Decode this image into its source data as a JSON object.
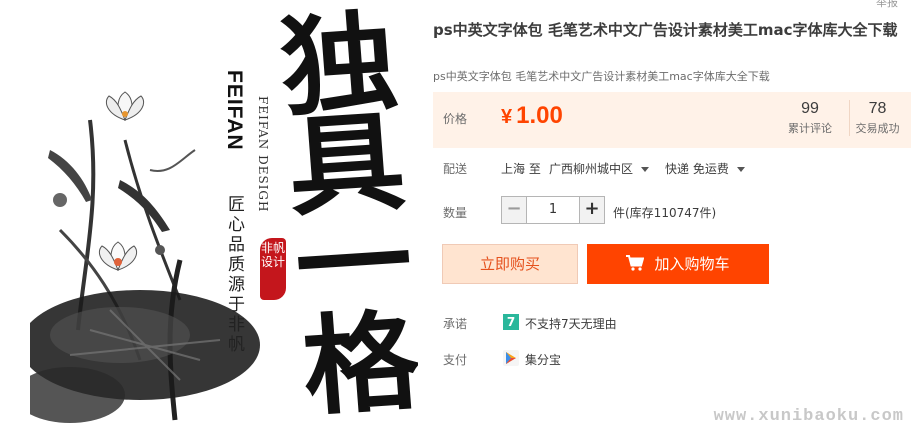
{
  "corner_text": "举报",
  "image": {
    "big_chars": [
      "独",
      "具",
      "一",
      "格"
    ],
    "brand": "FEIFAN",
    "brand_sub": "FEIFAN DESIGH",
    "slogan": "匠心品质源于非帆",
    "seal_text": "非帆设计"
  },
  "product": {
    "title": "ps中英文字体包 毛笔艺术中文广告设计素材美工mac字体库大全下载",
    "subtitle": "ps中英文字体包 毛笔艺术中文广告设计素材美工mac字体库大全下载"
  },
  "price": {
    "label": "价格",
    "currency": "¥",
    "value": "1.00",
    "reviews_count": "99",
    "reviews_label": "累计评论",
    "deals_count": "78",
    "deals_label": "交易成功"
  },
  "shipping": {
    "label": "配送",
    "from": "上海 至",
    "destination": "广西柳州城中区",
    "method": "快递 免运费"
  },
  "quantity": {
    "label": "数量",
    "minus": "−",
    "value": "1",
    "plus": "+",
    "stock": "件(库存110747件)"
  },
  "buttons": {
    "buy_now": "立即购买",
    "add_cart": "加入购物车"
  },
  "promise": {
    "label": "承诺",
    "badge": "7",
    "text": "不支持7天无理由"
  },
  "payment": {
    "label": "支付",
    "text": "集分宝"
  },
  "watermark": "www.xunibaoku.com",
  "colors": {
    "accent": "#ff4400",
    "price_bg": "#fff2e8",
    "promise_badge": "#2ab79b"
  }
}
